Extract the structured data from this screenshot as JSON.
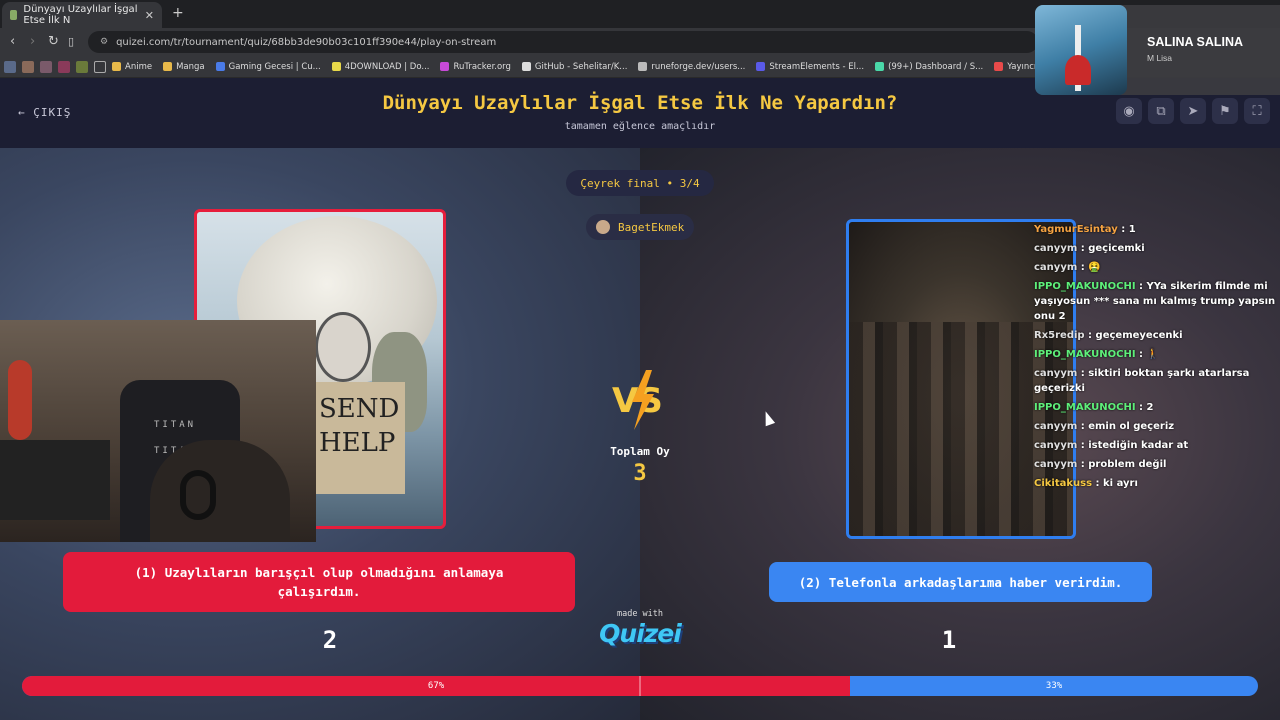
{
  "browser": {
    "tab_title": "Dünyayı Uzaylılar İşgal Etse İlk N",
    "tab_close": "✕",
    "new_tab": "+",
    "url": "quizei.com/tr/tournament/quiz/68bb3de90b03c101ff390e44/play-on-stream",
    "bookmarks": [
      {
        "label": "Anime",
        "color": "#e8b94a"
      },
      {
        "label": "Manga",
        "color": "#e8b94a"
      },
      {
        "label": "Gaming Gecesi | Cu...",
        "color": "#4a7be8"
      },
      {
        "label": "4DOWNLOAD | Do...",
        "color": "#e8d94a"
      },
      {
        "label": "RuTracker.org",
        "color": "#c84ad8"
      },
      {
        "label": "GitHub - Sehelitar/K...",
        "color": "#dddddd"
      },
      {
        "label": "runeforge.dev/users...",
        "color": "#bbbbbb"
      },
      {
        "label": "StreamElements - El...",
        "color": "#5a5ae8"
      },
      {
        "label": "(99+) Dashboard / S...",
        "color": "#4ad8a8"
      },
      {
        "label": "Yayıncı Paneli - Oyu...",
        "color": "#e84a4a"
      }
    ]
  },
  "header": {
    "exit_label": "ÇIKIŞ",
    "title": "Dünyayı Uzaylılar İşgal Etse İlk Ne Yapardın?",
    "subtitle": "tamamen eğlence amaçlıdır"
  },
  "stage": "Çeyrek final • 3/4",
  "user": "BagetEkmek",
  "webcam": {
    "chair_text_1": "TITAN",
    "chair_text_2": "TITAN"
  },
  "left_image": {
    "sign_text": "SEND HELP"
  },
  "vs": {
    "label": "VS",
    "total_label": "Toplam Oy",
    "total_value": "3"
  },
  "answers": {
    "left": "(1) Uzaylıların barışçıl olup olmadığını anlamaya çalışırdım.",
    "right": "(2) Telefonla arkadaşlarıma haber verirdim."
  },
  "votes": {
    "left": "2",
    "right": "1",
    "left_pct_label": "67%",
    "right_pct_label": "33%",
    "left_fraction": 0.67
  },
  "made_with": "made with",
  "brand": "Quizei",
  "chat": [
    {
      "user": "YagmurEsintay",
      "color": "#f5a342",
      "text": "1"
    },
    {
      "user": "canyym",
      "color": "#e0e0e0",
      "text": "geçicemki"
    },
    {
      "user": "canyym",
      "color": "#e0e0e0",
      "text": "🤮"
    },
    {
      "user": "IPPO_MAKUNOCHI",
      "color": "#5ef07a",
      "text": "YYa sikerim filmde mi yaşıyosun *** sana mı kalmış trump yapsın onu 2"
    },
    {
      "user": "Rx5redip",
      "color": "#e0e0e0",
      "text": "geçemeyecenki"
    },
    {
      "user": "IPPO_MAKUNOCHI",
      "color": "#5ef07a",
      "text": "🚶"
    },
    {
      "user": "canyym",
      "color": "#e0e0e0",
      "text": "siktiri boktan şarkı atarlarsa geçerizki"
    },
    {
      "user": "IPPO_MAKUNOCHI",
      "color": "#5ef07a",
      "text": "2"
    },
    {
      "user": "canyym",
      "color": "#e0e0e0",
      "text": "emin ol geçeriz"
    },
    {
      "user": "canyym",
      "color": "#e0e0e0",
      "text": "istediğin kadar at"
    },
    {
      "user": "canyym",
      "color": "#e0e0e0",
      "text": "problem değil"
    },
    {
      "user": "Cikitakuss",
      "color": "#f5c842",
      "text": "ki ayrı"
    }
  ],
  "player": {
    "song": "SALINA SALINA",
    "artist": "M Lisa"
  },
  "colors": {
    "accent_yellow": "#f5c842",
    "red": "#e31b3b",
    "blue": "#3a86f2"
  }
}
